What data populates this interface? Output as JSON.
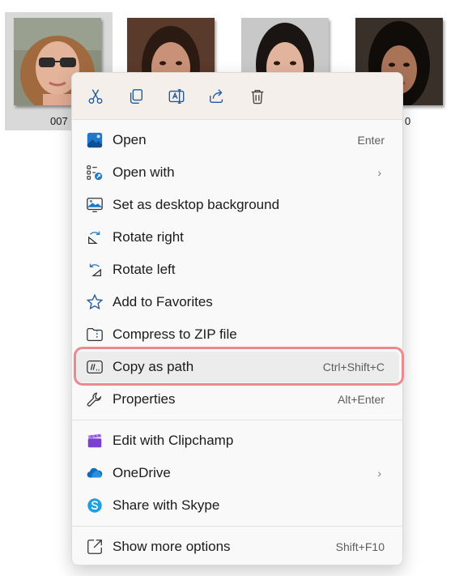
{
  "thumbnails": [
    {
      "label": "007",
      "selected": true
    },
    {
      "label": "",
      "selected": false
    },
    {
      "label": "",
      "selected": false
    },
    {
      "label": "0",
      "selected": false
    }
  ],
  "toolbar": {
    "items": [
      {
        "icon": "cut-icon"
      },
      {
        "icon": "copy-icon"
      },
      {
        "icon": "rename-icon"
      },
      {
        "icon": "share-icon"
      },
      {
        "icon": "delete-icon"
      }
    ]
  },
  "menu": {
    "items": [
      {
        "label": "Open",
        "shortcut": "Enter",
        "icon": "photos-icon"
      },
      {
        "label": "Open with",
        "shortcut": "",
        "icon": "open-with-icon",
        "submenu": true
      },
      {
        "label": "Set as desktop background",
        "shortcut": "",
        "icon": "desktop-background-icon"
      },
      {
        "label": "Rotate right",
        "shortcut": "",
        "icon": "rotate-right-icon"
      },
      {
        "label": "Rotate left",
        "shortcut": "",
        "icon": "rotate-left-icon"
      },
      {
        "label": "Add to Favorites",
        "shortcut": "",
        "icon": "star-icon"
      },
      {
        "label": "Compress to ZIP file",
        "shortcut": "",
        "icon": "zip-icon"
      },
      {
        "label": "Copy as path",
        "shortcut": "Ctrl+Shift+C",
        "icon": "copy-path-icon",
        "highlighted": true
      },
      {
        "label": "Properties",
        "shortcut": "Alt+Enter",
        "icon": "wrench-icon"
      },
      {
        "label": "Edit with Clipchamp",
        "shortcut": "",
        "icon": "clipchamp-icon"
      },
      {
        "label": "OneDrive",
        "shortcut": "",
        "icon": "onedrive-icon",
        "submenu": true
      },
      {
        "label": "Share with Skype",
        "shortcut": "",
        "icon": "skype-icon"
      },
      {
        "label": "Show more options",
        "shortcut": "Shift+F10",
        "icon": "more-options-icon"
      }
    ],
    "submenu_glyph": "›"
  },
  "colors": {
    "highlight_ring": "#ea8a8f",
    "accent": "#0f6cbd",
    "toolbar_bg": "#f4efea"
  }
}
